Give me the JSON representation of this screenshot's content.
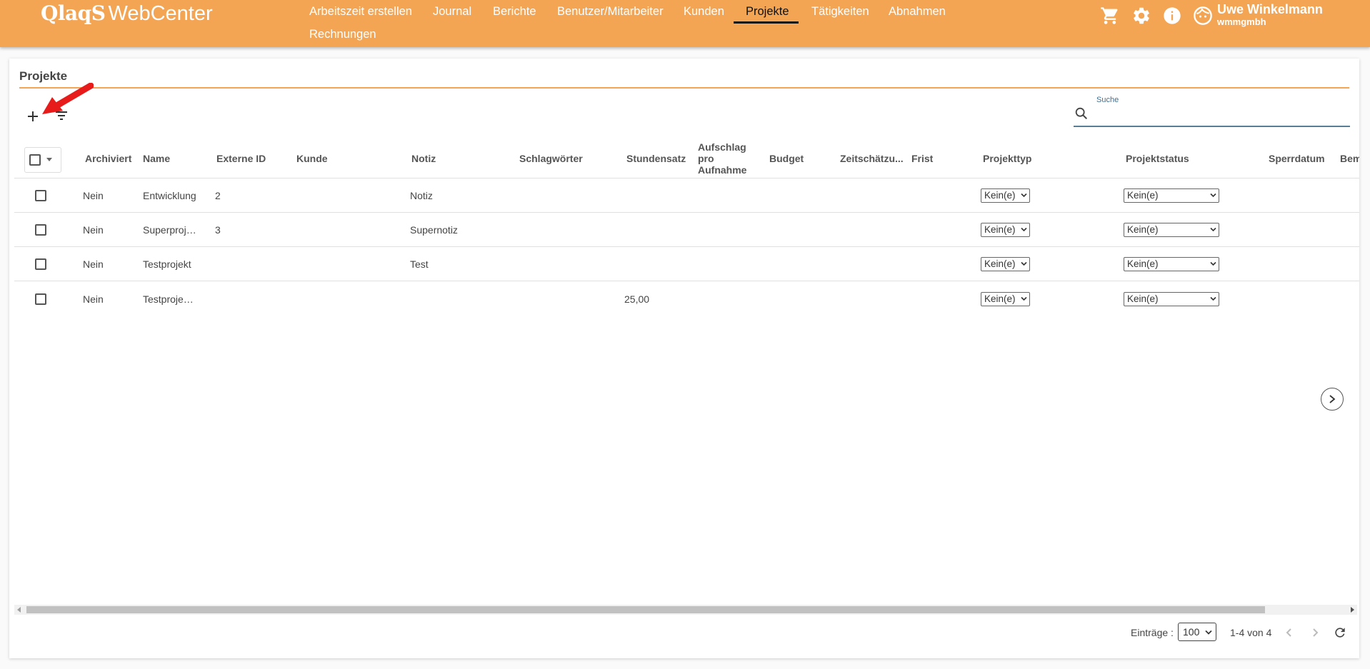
{
  "app": {
    "logo_brand": "QlaqS",
    "logo_suffix": "WebCenter"
  },
  "nav": {
    "items": [
      {
        "label": "Arbeitszeit erstellen"
      },
      {
        "label": "Journal"
      },
      {
        "label": "Berichte"
      },
      {
        "label": "Benutzer/Mitarbeiter"
      },
      {
        "label": "Kunden"
      },
      {
        "label": "Projekte"
      },
      {
        "label": "Tätigkeiten"
      },
      {
        "label": "Abnahmen"
      },
      {
        "label": "Rechnungen"
      }
    ],
    "active": "Projekte"
  },
  "toolbar_icons": [
    "cart-icon",
    "settings-gear-icon",
    "info-icon",
    "user-face-icon"
  ],
  "user": {
    "name": "Uwe Winkelmann",
    "company": "wmmgmbh"
  },
  "page": {
    "title": "Projekte"
  },
  "search": {
    "label": "Suche",
    "value": ""
  },
  "table": {
    "columns": [
      "Archiviert",
      "Name",
      "Externe ID",
      "Kunde",
      "Notiz",
      "Schlagwörter",
      "Stundensatz",
      "Aufschlag pro Aufnahme",
      "Budget",
      "Zeitschätzu...",
      "Frist",
      "Projekttyp",
      "Projektstatus",
      "Sperrdatum",
      "Beme"
    ],
    "rows": [
      {
        "archiviert": "Nein",
        "name": "Entwicklung",
        "externe_id": "2",
        "kunde": "",
        "notiz": "Notiz",
        "stundensatz": "",
        "projekttyp": "Kein(e)",
        "projektstatus": "Kein(e)"
      },
      {
        "archiviert": "Nein",
        "name": "Superproj…",
        "externe_id": "3",
        "kunde": "",
        "notiz": "Supernotiz",
        "stundensatz": "",
        "projekttyp": "Kein(e)",
        "projektstatus": "Kein(e)"
      },
      {
        "archiviert": "Nein",
        "name": "Testprojekt",
        "externe_id": "",
        "kunde": "",
        "notiz": "Test",
        "stundensatz": "",
        "projekttyp": "Kein(e)",
        "projektstatus": "Kein(e)"
      },
      {
        "archiviert": "Nein",
        "name": "Testproje…",
        "externe_id": "",
        "kunde": "",
        "notiz": "",
        "stundensatz": "25,00",
        "projekttyp": "Kein(e)",
        "projektstatus": "Kein(e)"
      }
    ]
  },
  "pagination": {
    "label": "Einträge :",
    "page_size": "100",
    "range": "1-4 von 4"
  },
  "colors": {
    "topbar": "#f4a553",
    "accent_line": "#f4a553",
    "search_line": "#5a7d96",
    "annotation_arrow": "#e81b1b"
  }
}
